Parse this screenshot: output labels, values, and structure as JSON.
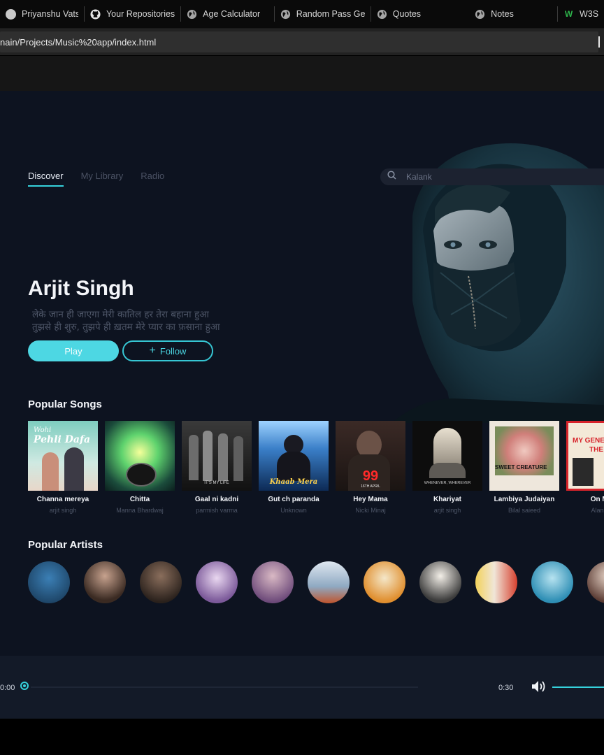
{
  "bookmarks": [
    {
      "label": "Priyanshu Vatsyan",
      "icon": "generic-favicon"
    },
    {
      "label": "Your Repositories",
      "icon": "github-icon"
    },
    {
      "label": "Age Calculator",
      "icon": "globe-icon"
    },
    {
      "label": "Random Pass Gen",
      "icon": "globe-icon"
    },
    {
      "label": "Quotes",
      "icon": "globe-icon"
    },
    {
      "label": "Notes",
      "icon": "globe-icon"
    },
    {
      "label": "W3S",
      "icon": "w3schools-icon"
    }
  ],
  "address": "nain/Projects/Music%20app/index.html",
  "nav": {
    "items": [
      "Discover",
      "My Library",
      "Radio"
    ],
    "active": "Discover"
  },
  "search": {
    "value": "",
    "placeholder": "Kalank"
  },
  "hero": {
    "artist": "Arjit Singh",
    "lyric1": "लेके जान ही जाएगा मेरी कातिल हर तेरा बहाना हुआ",
    "lyric2": "तुझसे ही शुरु, तुझपे ही ख़तम मेरे प्यार का फ़साना हुआ",
    "play_label": "Play",
    "follow_label": "Follow"
  },
  "popular_songs": {
    "title": "Popular Songs",
    "items": [
      {
        "title": "Channa mereya",
        "artist": "arjit singh"
      },
      {
        "title": "Chitta",
        "artist": "Manna Bhardwaj"
      },
      {
        "title": "Gaal ni kadni",
        "artist": "parmish varma"
      },
      {
        "title": "Gut ch paranda",
        "artist": "Unknown"
      },
      {
        "title": "Hey Mama",
        "artist": "Nicki Minaj"
      },
      {
        "title": "Khariyat",
        "artist": "arjit singh"
      },
      {
        "title": "Lambiya Judaiyan",
        "artist": "Bilal saieed"
      },
      {
        "title": "On My",
        "artist": "Alan W"
      }
    ]
  },
  "popular_artists": {
    "title": "Popular Artists",
    "count": 11
  },
  "covers": {
    "c0": {
      "line1": "Wohi",
      "line2": "Pehli Dafa"
    },
    "c2": {
      "text": "IT'S MY LIFE"
    },
    "c3": {
      "text": "Khaab Mera"
    },
    "c4": {
      "number": "99",
      "date": "16TH APRIL"
    },
    "c5": {
      "text": "WHENEVER, WHEREVER"
    },
    "c6": {
      "text": "SWEET CREATURE"
    },
    "c7": {
      "line1": "MY GENE",
      "line2": "THE W"
    }
  },
  "player": {
    "current_time": "0:00",
    "duration": "0:30",
    "progress": 0.0,
    "volume": 1.0
  },
  "colors": {
    "accent": "#36d1dc",
    "background": "#0d1320",
    "player_bg": "#131a28"
  }
}
